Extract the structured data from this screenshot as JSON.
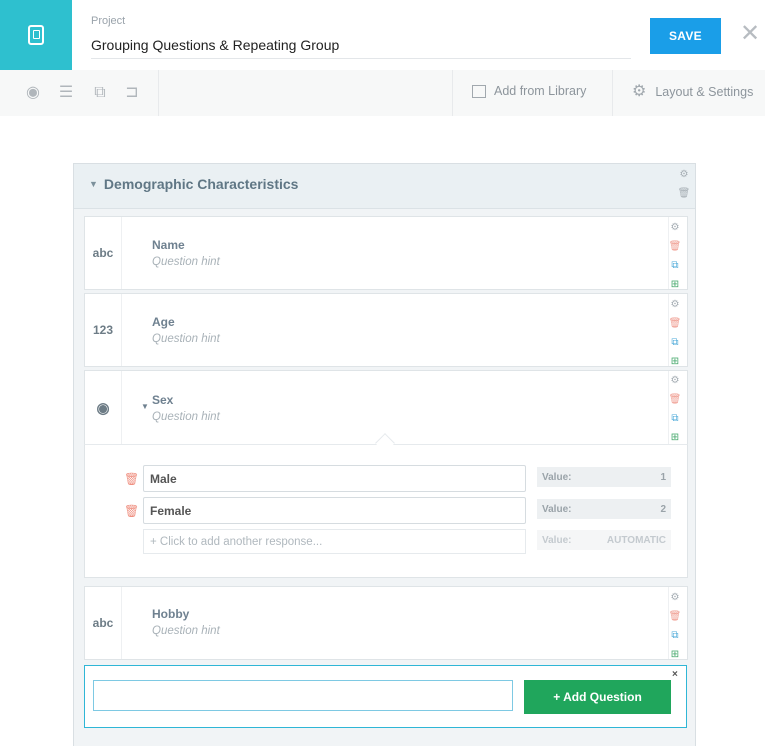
{
  "header": {
    "project_label": "Project",
    "project_title": "Grouping Questions & Repeating Group",
    "save_label": "SAVE",
    "close_symbol": "✕"
  },
  "toolbar": {
    "icons": [
      "eye-icon",
      "list-icon",
      "copy-icon",
      "branch-icon"
    ],
    "add_from_library": "Add from Library",
    "layout_settings": "Layout & Settings"
  },
  "group": {
    "title": "Demographic Characteristics",
    "questions": [
      {
        "type_label": "abc",
        "title": "Name",
        "hint": "Question hint"
      },
      {
        "type_label": "123",
        "title": "Age",
        "hint": "Question hint"
      },
      {
        "type_label": "◉",
        "title": "Sex",
        "hint": "Question hint"
      },
      {
        "type_label": "abc",
        "title": "Hobby",
        "hint": "Question hint"
      }
    ],
    "sex_options": [
      {
        "label": "Male",
        "value_label": "Value:",
        "value": "1"
      },
      {
        "label": "Female",
        "value_label": "Value:",
        "value": "2"
      }
    ],
    "add_response": {
      "placeholder": "+ Click to add another response...",
      "value_label": "Value:",
      "value": "AUTOMATIC"
    }
  },
  "add_bar": {
    "button_label": "+ Add Question",
    "close_symbol": "×",
    "input_value": ""
  },
  "colors": {
    "brand": "#2ec0cf",
    "save": "#1a9ee8",
    "add_question": "#20a65c"
  }
}
